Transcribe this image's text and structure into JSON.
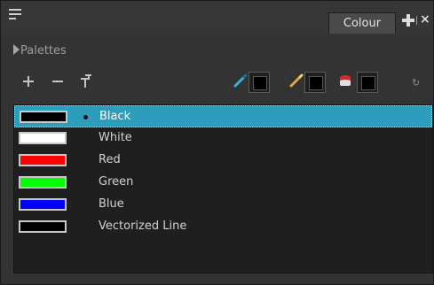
{
  "window": {
    "tab_label": "Colour",
    "close_label": "×"
  },
  "palettes": {
    "label": "Palettes"
  },
  "toolbar": {
    "icons": {
      "add": "plus-icon",
      "remove": "minus-icon",
      "clone": "clone-icon",
      "pencil_contour": "pen-icon",
      "pencil_fill": "brush-icon",
      "paint": "paint-bucket-icon",
      "link": "link-icon"
    },
    "swatches": [
      "#000000",
      "#000000",
      "#000000"
    ]
  },
  "colors": [
    {
      "name": "Black",
      "color": "#000000",
      "selected": true
    },
    {
      "name": "White",
      "color": "#ffffff",
      "selected": false
    },
    {
      "name": "Red",
      "color": "#ff0000",
      "selected": false
    },
    {
      "name": "Green",
      "color": "#00ff00",
      "selected": false
    },
    {
      "name": "Blue",
      "color": "#0000ff",
      "selected": false
    },
    {
      "name": "Vectorized Line",
      "color": "#000000",
      "selected": false
    }
  ],
  "theme": {
    "selection": "#2d9dbd",
    "panel_bg": "#333333",
    "list_bg": "#1f1f1f"
  }
}
